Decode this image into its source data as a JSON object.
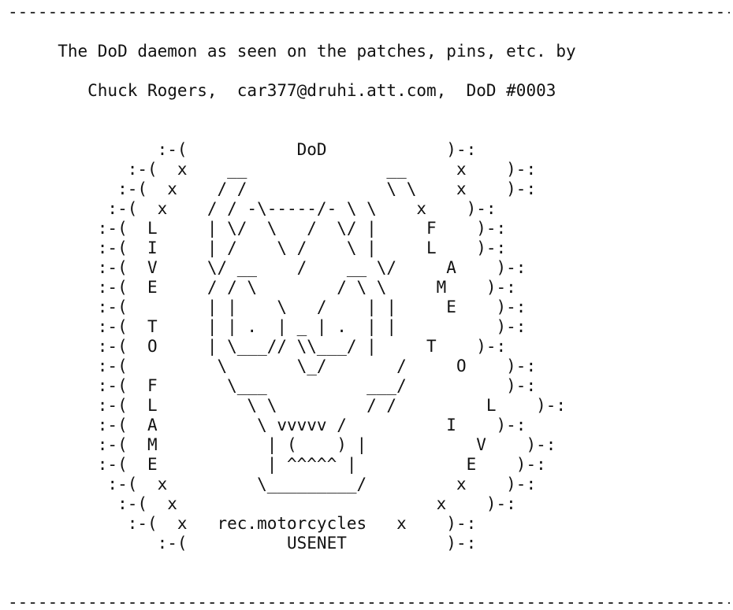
{
  "document": {
    "divider_top": "-----------------------------------------------------------------------------------",
    "intro_line": "     The DoD daemon as seen on the patches, pins, etc. by",
    "byline": "        Chuck Rogers,  car377@druhi.att.com,  DoD #0003",
    "art_lines": [
      "               :-(           DoD            )-:",
      "            :-(  x    __              __     x    )-:",
      "           :-(  x    / /              \\ \\    x    )-:",
      "          :-(  x    / / -\\-----/- \\ \\    x    )-:",
      "         :-(  L     | \\/  \\   /  \\/ |     F    )-:",
      "         :-(  I     | /    \\ /    \\ |     L    )-:",
      "         :-(  V     \\/ __    /    __ \\/     A    )-:",
      "         :-(  E     / / \\        / \\ \\     M    )-:",
      "         :-(        | |    \\   /    | |     E    )-:",
      "         :-(  T     | | .  | _ | .  | |          )-:",
      "         :-(  O     | \\___// \\\\___/ |     T    )-:",
      "         :-(         \\       \\_/       /     O    )-:",
      "         :-(  F       \\___          ___/          )-:",
      "         :-(  L         \\ \\         / /         L    )-:",
      "         :-(  A          \\ vvvvv /          I    )-:",
      "         :-(  M           | (    ) |           V    )-:",
      "         :-(  E           | ^^^^^ |           E    )-:",
      "          :-(  x         \\_________/         x    )-:",
      "           :-(  x                          x    )-:",
      "            :-(  x   rec.motorcycles   x    )-:",
      "               :-(          USENET          )-:"
    ],
    "divider_bottom": "-----------------------------------------------------------------------------------"
  }
}
